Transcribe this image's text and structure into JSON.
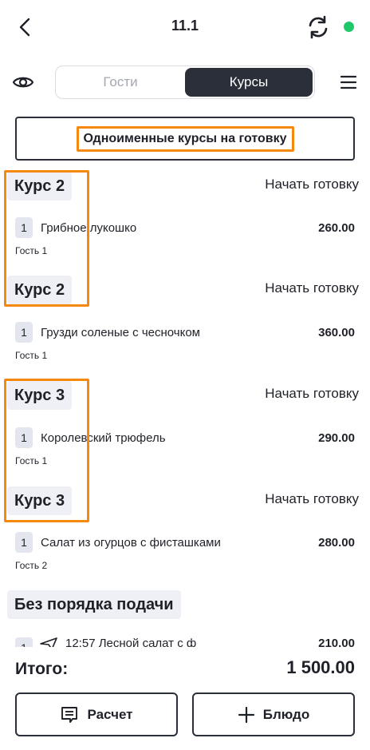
{
  "header": {
    "title": "11.1",
    "status_color": "#1fc96a"
  },
  "toolbar": {
    "tabs": [
      {
        "label": "Гости",
        "active": false
      },
      {
        "label": "Курсы",
        "active": true
      }
    ]
  },
  "fire_all": {
    "label": "Одноименные курсы на готовку"
  },
  "courses": [
    {
      "title": "Курс 2",
      "action": "Начать готовку",
      "qty": "1",
      "dish": "Грибное лукошко",
      "price": "260.00",
      "guest": "Гость 1"
    },
    {
      "title": "Курс 2",
      "action": "Начать готовку",
      "qty": "1",
      "dish": "Грузди соленые с чесночком",
      "price": "360.00",
      "guest": "Гость 1"
    },
    {
      "title": "Курс 3",
      "action": "Начать готовку",
      "qty": "1",
      "dish": "Королевский трюфель",
      "price": "290.00",
      "guest": "Гость 1"
    },
    {
      "title": "Курс 3",
      "action": "Начать готовку",
      "qty": "1",
      "dish": "Салат из огурцов с фисташками",
      "price": "280.00",
      "guest": "Гость 2"
    }
  ],
  "no_order": {
    "title": "Без порядка подачи",
    "partial_item": {
      "qty": "1",
      "dish": "12:57  Лесной салат с ф",
      "price": "210.00"
    }
  },
  "footer": {
    "total_label": "Итого:",
    "total_value": "1 500.00",
    "bill_label": "Расчет",
    "add_dish_label": "Блюдо"
  },
  "colors": {
    "accent_dark": "#2b2f3a",
    "highlight": "#f5890f",
    "chip_bg": "#eef0f5"
  }
}
